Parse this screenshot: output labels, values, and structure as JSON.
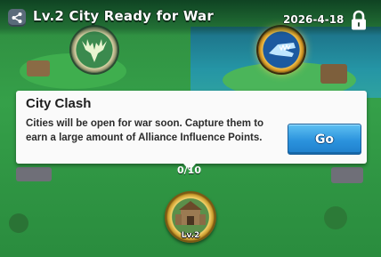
{
  "header": {
    "share_icon": "share-icon",
    "title": "Lv.2 City Ready for War",
    "date": "2026-4-18",
    "lock_icon": "lock-icon"
  },
  "map": {
    "left_emblem_icon": "deer-emblem-icon",
    "right_emblem_icon": "crocodile-emblem-icon",
    "partial_label": "0/10",
    "city_marker_icon": "city-icon",
    "city_level": "Lv.2"
  },
  "popup": {
    "title": "City Clash",
    "body": "Cities will be open for war soon. Capture them to earn a large amount of Alliance Influence Points.",
    "go_label": "Go"
  },
  "colors": {
    "grass": "#35a049",
    "water": "#2595a5",
    "button_blue": "#2b93dd",
    "popup_bg": "#fafafa"
  }
}
